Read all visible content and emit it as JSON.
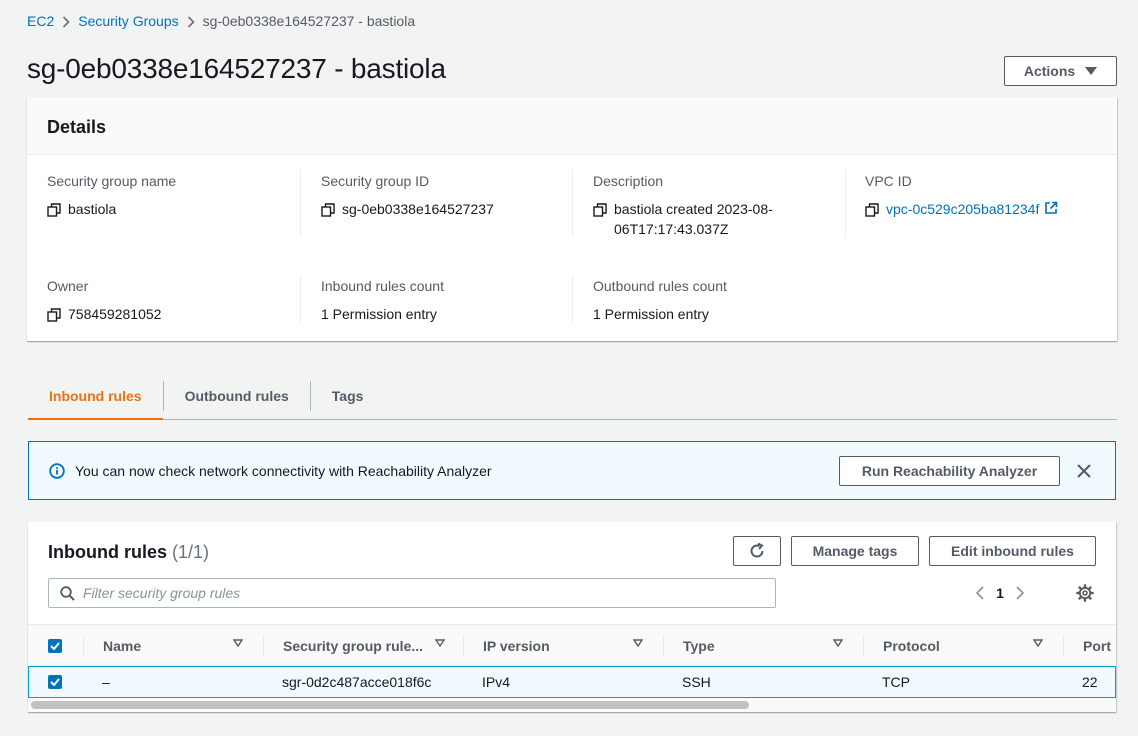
{
  "breadcrumb": {
    "items": [
      {
        "label": "EC2"
      },
      {
        "label": "Security Groups"
      }
    ],
    "current": "sg-0eb0338e164527237 - bastiola"
  },
  "page_title": "sg-0eb0338e164527237 - bastiola",
  "actions_label": "Actions",
  "details": {
    "title": "Details",
    "fields": {
      "sg_name": {
        "label": "Security group name",
        "value": "bastiola"
      },
      "sg_id": {
        "label": "Security group ID",
        "value": "sg-0eb0338e164527237"
      },
      "description": {
        "label": "Description",
        "value": "bastiola created 2023-08-06T17:17:43.037Z"
      },
      "vpc_id": {
        "label": "VPC ID",
        "value": "vpc-0c529c205ba81234f"
      },
      "owner": {
        "label": "Owner",
        "value": "758459281052"
      },
      "inbound_count": {
        "label": "Inbound rules count",
        "value": "1 Permission entry"
      },
      "outbound_count": {
        "label": "Outbound rules count",
        "value": "1 Permission entry"
      }
    }
  },
  "tabs": [
    {
      "label": "Inbound rules",
      "active": true
    },
    {
      "label": "Outbound rules",
      "active": false
    },
    {
      "label": "Tags",
      "active": false
    }
  ],
  "alert": {
    "message": "You can now check network connectivity with Reachability Analyzer",
    "button": "Run Reachability Analyzer"
  },
  "inbound": {
    "title": "Inbound rules",
    "count": "(1/1)",
    "manage_tags": "Manage tags",
    "edit_rules": "Edit inbound rules",
    "filter_placeholder": "Filter security group rules",
    "page": "1",
    "columns": [
      "Name",
      "Security group rule...",
      "IP version",
      "Type",
      "Protocol",
      "Port"
    ],
    "rows": [
      {
        "name": "–",
        "rule_id": "sgr-0d2c487acce018f6c",
        "ip_version": "IPv4",
        "type": "SSH",
        "protocol": "TCP",
        "port": "22",
        "selected": true
      }
    ]
  },
  "colors": {
    "link": "#0073bb",
    "accent_tab": "#ec7211",
    "alert_bg": "#f1faff",
    "alert_border": "#0073bb"
  }
}
